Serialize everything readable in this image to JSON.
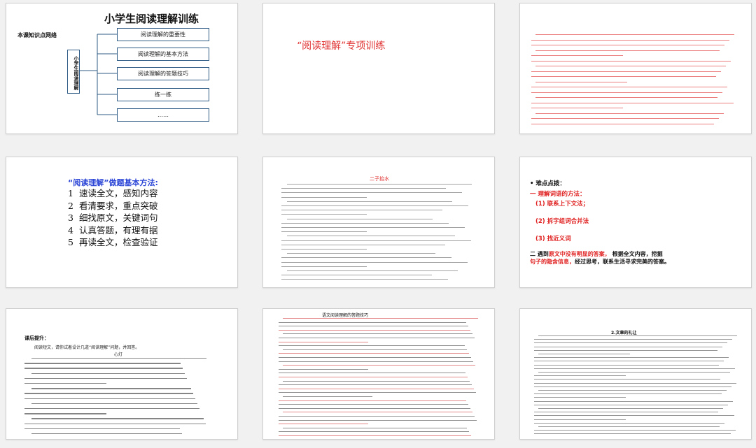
{
  "slide1": {
    "title": "小学生阅读理解训练",
    "subtitle": "本课知识点网络",
    "vertical_label": "小学生阅读理解",
    "items": [
      "阅读理解的重要性",
      "阅读理解的基本方法",
      "阅读理解的答题技巧",
      "练一练",
      "……"
    ],
    "border_color": "#2e5b86"
  },
  "slide2": {
    "title": "“阅读理解”专项训练",
    "title_color": "#e03030"
  },
  "slide4": {
    "title": "“阅读理解”做题基本方法:",
    "title_color": "#2a45d6",
    "steps": [
      {
        "num": "1",
        "text": "速读全文，感知内容"
      },
      {
        "num": "2",
        "text": "看清要求，重点突破"
      },
      {
        "num": "3",
        "text": "细找原文，关键词句"
      },
      {
        "num": "4",
        "text": "认真答题，有理有据"
      },
      {
        "num": "5",
        "text": "再读全文，检查验证"
      }
    ]
  },
  "slide5": {
    "title": "二子抬水"
  },
  "slide6": {
    "heading": "• 难点点拨：",
    "point1": "一 理解词语的方法：",
    "point1a": "(1) 联系上下文法；",
    "point1b": "(2) 拆字组词合并法",
    "point1c": "(3) 找近义词",
    "point2_black1": "二 遇到",
    "point2_red": "原文中没有明显的答案，",
    "point2_black2": "   根据全文内容，挖掘",
    "point2_line2_red": "句子的隐含信息，",
    "point2_line2_black": "经过思考，联系生活寻求完美的答案。",
    "accent": "#e02020"
  },
  "slide7": {
    "heading": "课后提升：",
    "intro": "阅读短文，请你试着设计几道“阅读理解”问题，并回答。",
    "story_title": "心灯"
  },
  "slide8": {
    "title": "语文阅读理解的答题技巧"
  },
  "slide9": {
    "title": "2.文章的礼让"
  }
}
